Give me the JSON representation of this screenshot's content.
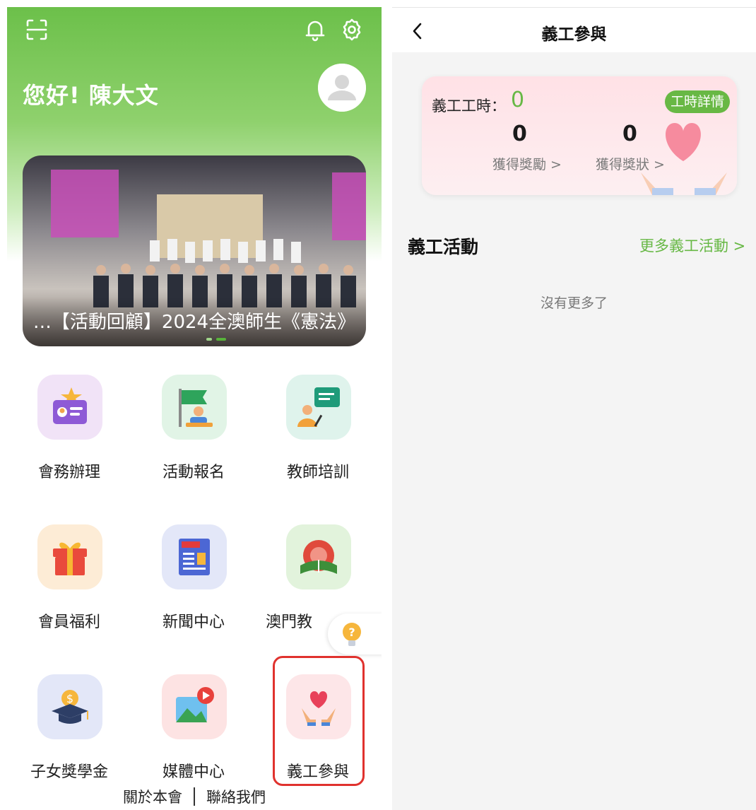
{
  "left": {
    "greeting": "您好! 陳大文",
    "banner": {
      "caption": "…【活動回顧】2024全澳師生《憲法》"
    },
    "menu": [
      {
        "label": "會務辦理",
        "icon": "member-card-icon"
      },
      {
        "label": "活動報名",
        "icon": "flag-signup-icon"
      },
      {
        "label": "教師培訓",
        "icon": "teacher-training-icon"
      },
      {
        "label": "會員福利",
        "icon": "gift-icon"
      },
      {
        "label": "新聞中心",
        "icon": "newspaper-icon"
      },
      {
        "label": "澳門教",
        "icon": "macau-education-icon"
      },
      {
        "label": "子女獎學金",
        "icon": "graduation-cap-icon"
      },
      {
        "label": "媒體中心",
        "icon": "media-icon"
      },
      {
        "label": "義工參與",
        "icon": "volunteer-heart-icon"
      }
    ],
    "footer": {
      "about": "關於本會",
      "contact": "聯絡我們"
    }
  },
  "right": {
    "title": "義工參與",
    "card": {
      "hours_label": "義工工時：",
      "hours_value": "0",
      "detail_button": "工時詳情",
      "rewards_count": "0",
      "rewards_label": "獲得獎勵 >",
      "awards_count": "0",
      "awards_label": "獲得獎狀 >"
    },
    "section": {
      "title": "義工活動",
      "more": "更多義工活動 >"
    },
    "empty_text": "沒有更多了"
  },
  "colors": {
    "accent_green": "#67b845",
    "highlight_red": "#e0322e",
    "card_pink": "#ffe1e6"
  }
}
